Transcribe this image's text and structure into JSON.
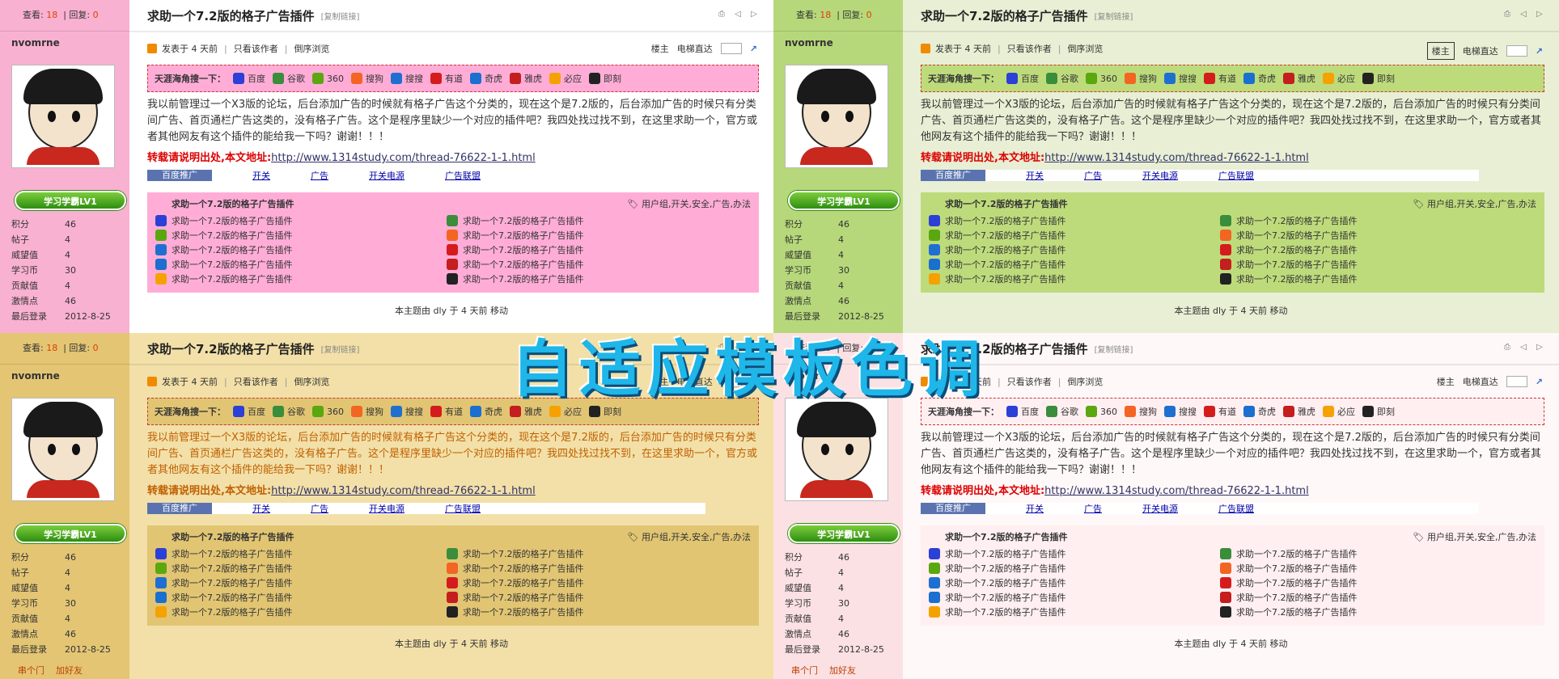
{
  "thread": {
    "stats_view_label": "查看:",
    "stats_view_value": "18",
    "stats_reply_label": "回复:",
    "stats_reply_value": "0",
    "title": "求助一个7.2版的格子广告插件",
    "copy_link": "[复制链接]",
    "username": "nvomrne",
    "medal_text": "学习学霸LV1",
    "posted": "发表于 4 天前",
    "only_author": "只看该作者",
    "reverse": "倒序浏览",
    "owner": "楼主",
    "elevator": "电梯直达",
    "search_label": "天涯海角搜一下：",
    "engines": [
      {
        "name": "百度",
        "icon": "baidu-icon",
        "color": "#2c3fd6"
      },
      {
        "name": "谷歌",
        "icon": "google-icon",
        "color": "#3a8d3a"
      },
      {
        "name": "360",
        "icon": "360-icon",
        "color": "#5aa70f"
      },
      {
        "name": "搜狗",
        "icon": "sogou-icon",
        "color": "#f26522"
      },
      {
        "name": "搜搜",
        "icon": "soso-icon",
        "color": "#1f6fd1"
      },
      {
        "name": "有道",
        "icon": "youdao-icon",
        "color": "#d51c1c"
      },
      {
        "name": "奇虎",
        "icon": "qihoo-icon",
        "color": "#1a6fcf"
      },
      {
        "name": "雅虎",
        "icon": "yahoo-icon",
        "color": "#c41e1e"
      },
      {
        "name": "必应",
        "icon": "bing-icon",
        "color": "#f5a200"
      },
      {
        "name": "即刻",
        "icon": "jike-icon",
        "color": "#222222"
      }
    ],
    "content": "我以前管理过一个X3版的论坛，后台添加广告的时候就有格子广告这个分类的，现在这个是7.2版的，后台添加广告的时候只有分类间广告、首页通栏广告这类的，没有格子广告。这个是程序里缺少一个对应的插件吧？我四处找过找不到，在这里求助一个，官方或者其他网友有这个插件的能给我一下吗？谢谢！！！",
    "repost_label": "转载请说明出处,本文地址:",
    "repost_url": "http://www.1314study.com/thread-76622-1-1.html",
    "ad_links": [
      "百度推广",
      "开关",
      "广告",
      "开关电源",
      "广告联盟"
    ],
    "related_title": "求助一个7.2版的格子广告插件",
    "related_tags": "用户组,开关,安全,广告,办法",
    "related_items": [
      "求助一个7.2版的格子广告插件",
      "求助一个7.2版的格子广告插件",
      "求助一个7.2版的格子广告插件",
      "求助一个7.2版的格子广告插件",
      "求助一个7.2版的格子广告插件"
    ],
    "moved_note": "本主题由 dly 于 4 天前 移动",
    "info": [
      {
        "k": "积分",
        "v": "46"
      },
      {
        "k": "帖子",
        "v": "4"
      },
      {
        "k": "威望值",
        "v": "4"
      },
      {
        "k": "学习币",
        "v": "30"
      },
      {
        "k": "贡献值",
        "v": "4"
      },
      {
        "k": "激情点",
        "v": "46"
      },
      {
        "k": "最后登录",
        "v": "2012-8-25"
      }
    ],
    "bottom_links": [
      "串个门",
      "加好友"
    ]
  },
  "overlay_text": "自适应模板色调"
}
